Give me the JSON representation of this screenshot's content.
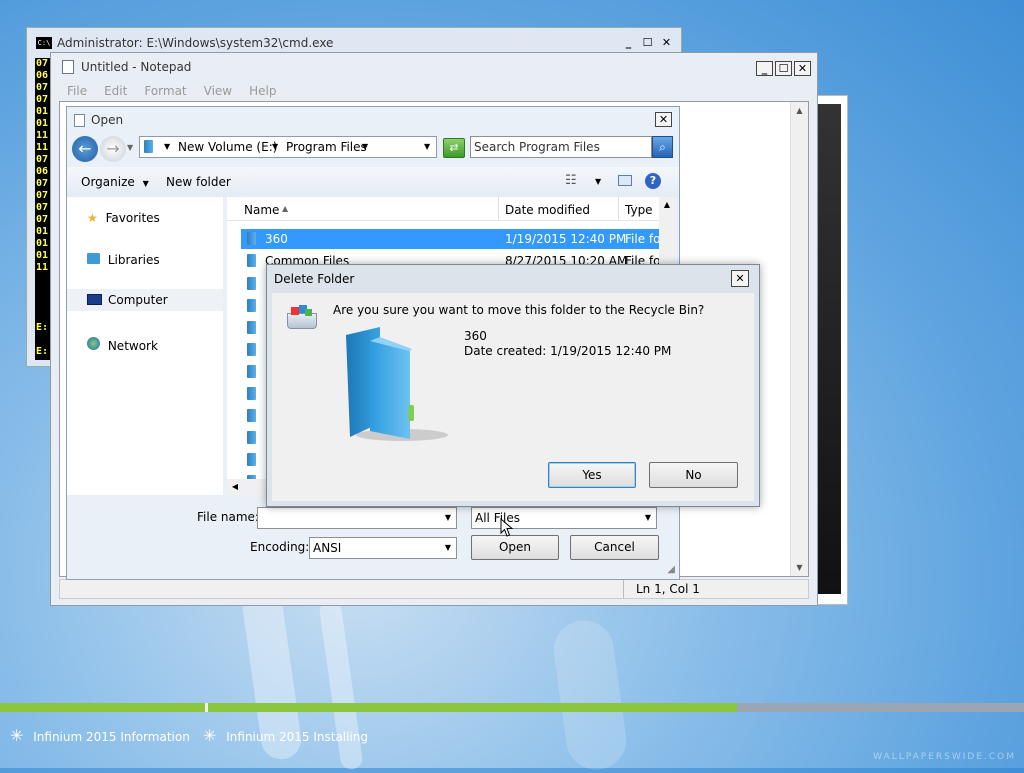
{
  "cmd": {
    "title": "Administrator: E:\\Windows\\system32\\cmd.exe",
    "icon_text": "C:\\",
    "lines": [
      "07",
      "06",
      "07",
      "07",
      "01",
      "01",
      "11",
      "11",
      "07",
      "06",
      "07",
      "07",
      "07",
      "07",
      "01",
      "01",
      "01",
      "11"
    ],
    "prompt1": "E:",
    "prompt2": "E:"
  },
  "notepad": {
    "title": "Untitled - Notepad",
    "menu": [
      "File",
      "Edit",
      "Format",
      "View",
      "Help"
    ],
    "status": "Ln 1, Col 1"
  },
  "open_dialog": {
    "title": "Open",
    "breadcrumb": [
      "New Volume (E:)",
      "Program Files"
    ],
    "search_placeholder": "Search Program Files",
    "organize": "Organize",
    "new_folder": "New folder",
    "nav": [
      "Favorites",
      "Libraries",
      "Computer",
      "Network"
    ],
    "columns": {
      "name": "Name",
      "date": "Date modified",
      "type": "Type"
    },
    "rows": [
      {
        "name": "360",
        "date": "1/19/2015 12:40 PM",
        "type": "File fol"
      },
      {
        "name": "Common Files",
        "date": "8/27/2015 10:20 AM",
        "type": "File fol"
      }
    ],
    "file_name_label": "File name:",
    "file_name_value": "",
    "filter_value": "All Files",
    "encoding_label": "Encoding:",
    "encoding_value": "ANSI",
    "open_button": "Open",
    "cancel_button": "Cancel"
  },
  "delete_dialog": {
    "title": "Delete Folder",
    "question": "Are you sure you want to move this folder to the Recycle Bin?",
    "item_name": "360",
    "date_created": "Date created: 1/19/2015 12:40 PM",
    "yes": "Yes",
    "no": "No"
  },
  "install": {
    "progress_fraction": 0.72,
    "item1": "Infinium 2015 Information",
    "item2": "Infinium 2015 Installing",
    "watermark": "WALLPAPERSWIDE.COM"
  },
  "colors": {
    "selection": "#3399ff",
    "progress": "#8cc63f",
    "folder": "#2d8fd5"
  }
}
